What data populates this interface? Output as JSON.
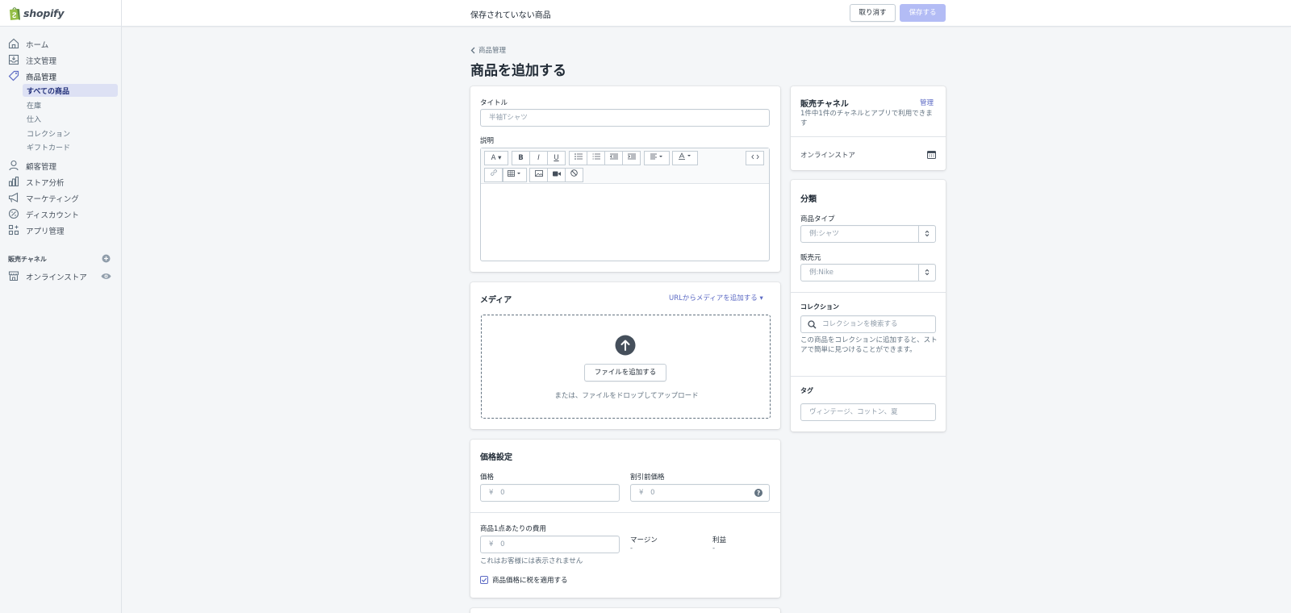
{
  "brand": {
    "name": "shopify",
    "accent": "#5c6ac4",
    "bag_color": "#95bf47"
  },
  "topbar": {
    "title": "保存されていない商品",
    "discard_label": "取り消す",
    "save_label": "保存する"
  },
  "sidebar": {
    "items": [
      {
        "label": "ホーム",
        "icon": "home-icon"
      },
      {
        "label": "注文管理",
        "icon": "orders-icon"
      },
      {
        "label": "商品管理",
        "icon": "tag-icon"
      },
      {
        "label": "顧客管理",
        "icon": "customer-icon"
      },
      {
        "label": "ストア分析",
        "icon": "analytics-icon"
      },
      {
        "label": "マーケティング",
        "icon": "megaphone-icon"
      },
      {
        "label": "ディスカウント",
        "icon": "discount-icon"
      },
      {
        "label": "アプリ管理",
        "icon": "apps-icon"
      }
    ],
    "subitems": [
      {
        "label": "すべての商品",
        "active": true
      },
      {
        "label": "在庫"
      },
      {
        "label": "仕入"
      },
      {
        "label": "コレクション"
      },
      {
        "label": "ギフトカード"
      }
    ],
    "sales_channels_title": "販売チャネル",
    "online_store_label": "オンラインストア"
  },
  "main": {
    "breadcrumb": "商品管理",
    "page_title": "商品を追加する",
    "title_label": "タイトル",
    "title_placeholder": "半袖Tシャツ",
    "description_label": "説明",
    "media": {
      "title": "メディア",
      "add_from_url": "URLからメディアを追加する",
      "add_file_button": "ファイルを追加する",
      "drop_hint": "または、ファイルをドロップしてアップロード"
    },
    "pricing": {
      "title": "価格設定",
      "price_label": "価格",
      "compare_label": "割引前価格",
      "currency": "¥",
      "price_placeholder": "0",
      "compare_placeholder": "0",
      "cost_label": "商品1点あたりの費用",
      "cost_placeholder": "0",
      "cost_hint": "これはお客様には表示されません",
      "margin_label": "マージン",
      "margin_value": "-",
      "profit_label": "利益",
      "profit_value": "-",
      "tax_checkbox_label": "商品価格に税を適用する",
      "tax_checked": true
    }
  },
  "right": {
    "channels": {
      "title": "販売チャネル",
      "manage_link": "管理",
      "desc": "1件中1件のチャネルとアプリで利用できます",
      "online_store": "オンラインストア"
    },
    "organization": {
      "title": "分類",
      "type_label": "商品タイプ",
      "type_placeholder": "例:シャツ",
      "vendor_label": "販売元",
      "vendor_placeholder": "例:Nike",
      "collections_title": "コレクション",
      "collections_placeholder": "コレクションを検索する",
      "collections_hint": "この商品をコレクションに追加すると、ストアで簡単に見つけることができます。",
      "tags_title": "タグ",
      "tags_placeholder": "ヴィンテージ、コットン、夏"
    }
  }
}
